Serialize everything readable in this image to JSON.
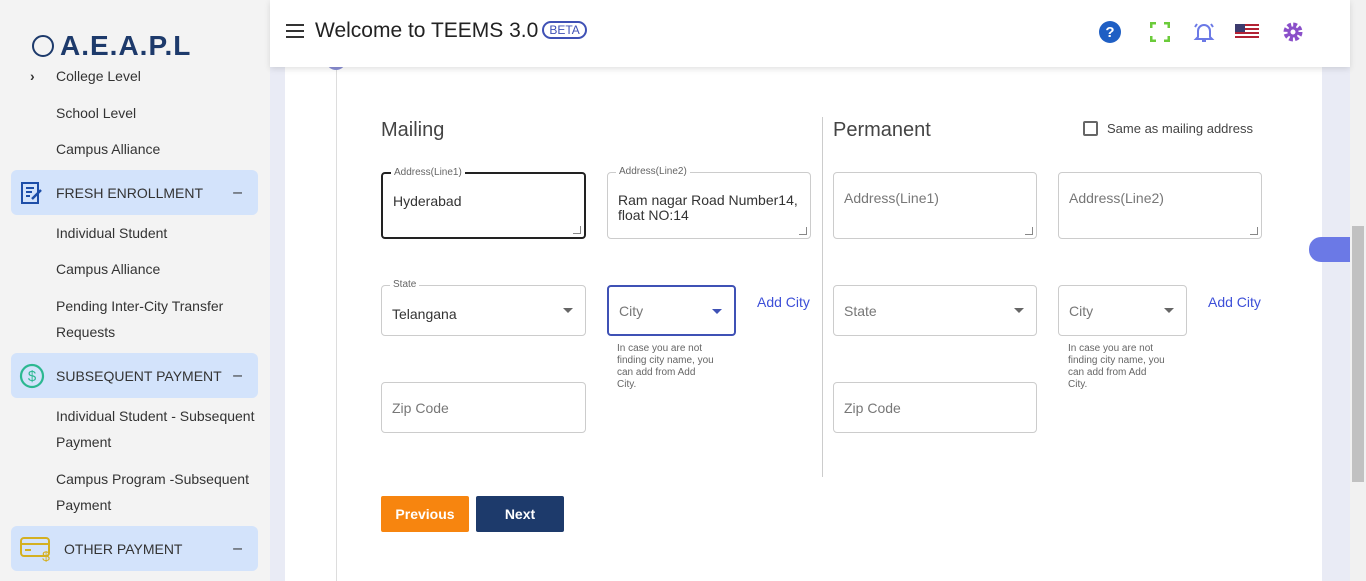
{
  "logo": {
    "text": "A.E.A.P.L"
  },
  "sidebar": {
    "college_level": "College Level",
    "school_level": "School Level",
    "campus_alliance_top": "Campus Alliance",
    "groups": [
      {
        "label": "FRESH ENROLLMENT",
        "icon": "form-edit-icon",
        "items": [
          "Individual Student",
          "Campus Alliance",
          "Pending Inter-City Transfer Requests"
        ]
      },
      {
        "label": "SUBSEQUENT PAYMENT",
        "icon": "dollar-circle-icon",
        "items": [
          "Individual Student - Subsequent Payment",
          "Campus Program -Subsequent Payment"
        ]
      },
      {
        "label": "OTHER PAYMENT",
        "icon": "card-dollar-icon",
        "items": []
      }
    ],
    "collapse_symbol": "–"
  },
  "header": {
    "title": "Welcome to TEEMS 3.0",
    "badge": "BETA"
  },
  "form": {
    "mailing": {
      "heading": "Mailing",
      "line1_label": "Address(Line1)",
      "line1": "Hyderabad",
      "line2_label": "Address(Line2)",
      "line2": "Ram nagar Road Number14, float NO:14",
      "state_label": "State",
      "state": "Telangana",
      "city_placeholder": "City",
      "add_city": "Add City",
      "city_help": "In case you are not finding city name, you can add from Add City.",
      "zip_placeholder": "Zip Code"
    },
    "permanent": {
      "heading": "Permanent",
      "same_as": "Same as mailing address",
      "line1_placeholder": "Address(Line1)",
      "line2_placeholder": "Address(Line2)",
      "state_placeholder": "State",
      "city_placeholder": "City",
      "add_city": "Add City",
      "city_help": "In case you are not finding city name, you can add from Add City.",
      "zip_placeholder": "Zip Code"
    },
    "previous": "Previous",
    "next": "Next"
  },
  "colors": {
    "previous": "#f7850f",
    "next": "#1d3a6b",
    "accent": "#3f51b5"
  }
}
